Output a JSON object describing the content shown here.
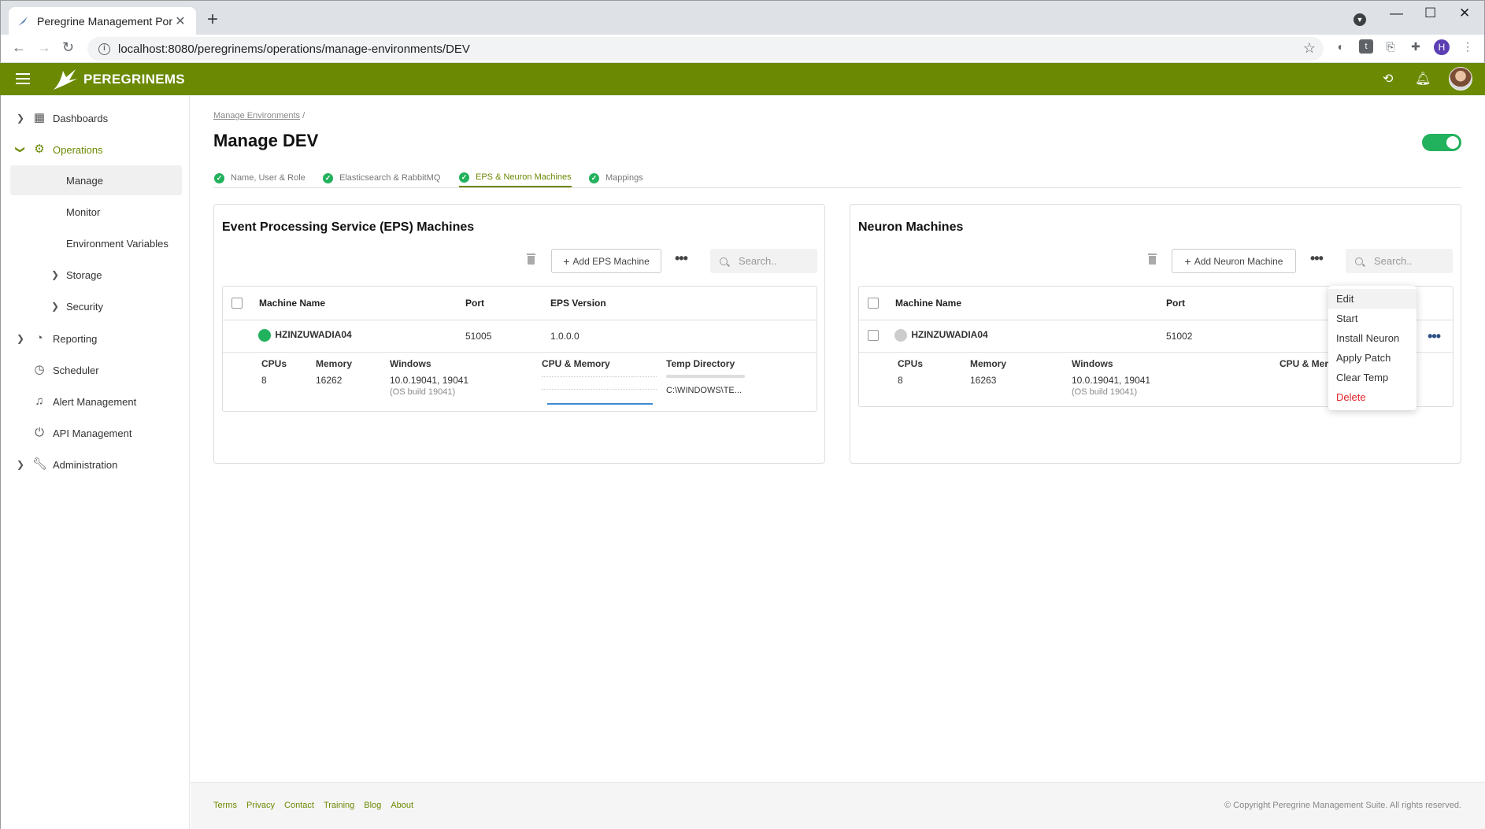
{
  "browser": {
    "tab_title": "Peregrine Management Portal",
    "url": "localhost:8080/peregrinems/operations/manage-environments/DEV",
    "profile_initial": "H"
  },
  "app": {
    "logo_text": "PEREGRINEMS"
  },
  "sidebar": {
    "items": [
      {
        "label": "Dashboards",
        "icon": "dashboard-icon"
      },
      {
        "label": "Operations",
        "icon": "gear-icon"
      },
      {
        "label": "Manage"
      },
      {
        "label": "Monitor"
      },
      {
        "label": "Environment Variables"
      },
      {
        "label": "Storage"
      },
      {
        "label": "Security"
      },
      {
        "label": "Reporting",
        "icon": "reporting-icon"
      },
      {
        "label": "Scheduler",
        "icon": "clock-icon"
      },
      {
        "label": "Alert Management",
        "icon": "bell-icon"
      },
      {
        "label": "API Management",
        "icon": "plug-icon"
      },
      {
        "label": "Administration",
        "icon": "wrench-icon"
      }
    ]
  },
  "main": {
    "breadcrumb": "Manage Environments",
    "breadcrumb_sep": "/",
    "title": "Manage DEV",
    "enabled": true,
    "steps": [
      {
        "label": "Name, User & Role"
      },
      {
        "label": "Elasticsearch & RabbitMQ"
      },
      {
        "label": "EPS & Neuron Machines"
      },
      {
        "label": "Mappings"
      }
    ]
  },
  "eps": {
    "title": "Event Processing Service (EPS) Machines",
    "add_label": "Add EPS Machine",
    "search_placeholder": "Search..",
    "columns": [
      "Machine Name",
      "Port",
      "EPS Version"
    ],
    "row": {
      "name": "HZINZUWADIA04",
      "port": "51005",
      "version": "1.0.0.0",
      "status": "online"
    },
    "detail": {
      "cpus_label": "CPUs",
      "cpus": "8",
      "memory_label": "Memory",
      "memory": "16262",
      "os_label": "Windows",
      "os_version": "10.0.19041, 19041",
      "os_build": "(OS build 19041)",
      "cpu_mem_label": "CPU & Memory",
      "temp_label": "Temp Directory",
      "temp_value": "C:\\WINDOWS\\TE..."
    }
  },
  "neuron": {
    "title": "Neuron Machines",
    "add_label": "Add Neuron Machine",
    "search_placeholder": "Search..",
    "columns": [
      "Machine Name",
      "Port"
    ],
    "row": {
      "name": "HZINZUWADIA04",
      "port": "51002",
      "status": "offline"
    },
    "detail": {
      "cpus_label": "CPUs",
      "cpus": "8",
      "memory_label": "Memory",
      "memory": "16263",
      "os_label": "Windows",
      "os_version": "10.0.19041, 19041",
      "os_build": "(OS build 19041)",
      "cpu_mem_label": "CPU & Mem"
    }
  },
  "context_menu": {
    "items": [
      "Edit",
      "Start",
      "Install Neuron",
      "Apply Patch",
      "Clear Temp",
      "Delete"
    ]
  },
  "footer": {
    "links": [
      "Terms",
      "Privacy",
      "Contact",
      "Training",
      "Blog",
      "About"
    ],
    "copyright": "© Copyright Peregrine Management Suite. All rights reserved."
  },
  "colors": {
    "brand": "#6b8903",
    "success": "#22b15c",
    "danger": "#e3242b"
  }
}
